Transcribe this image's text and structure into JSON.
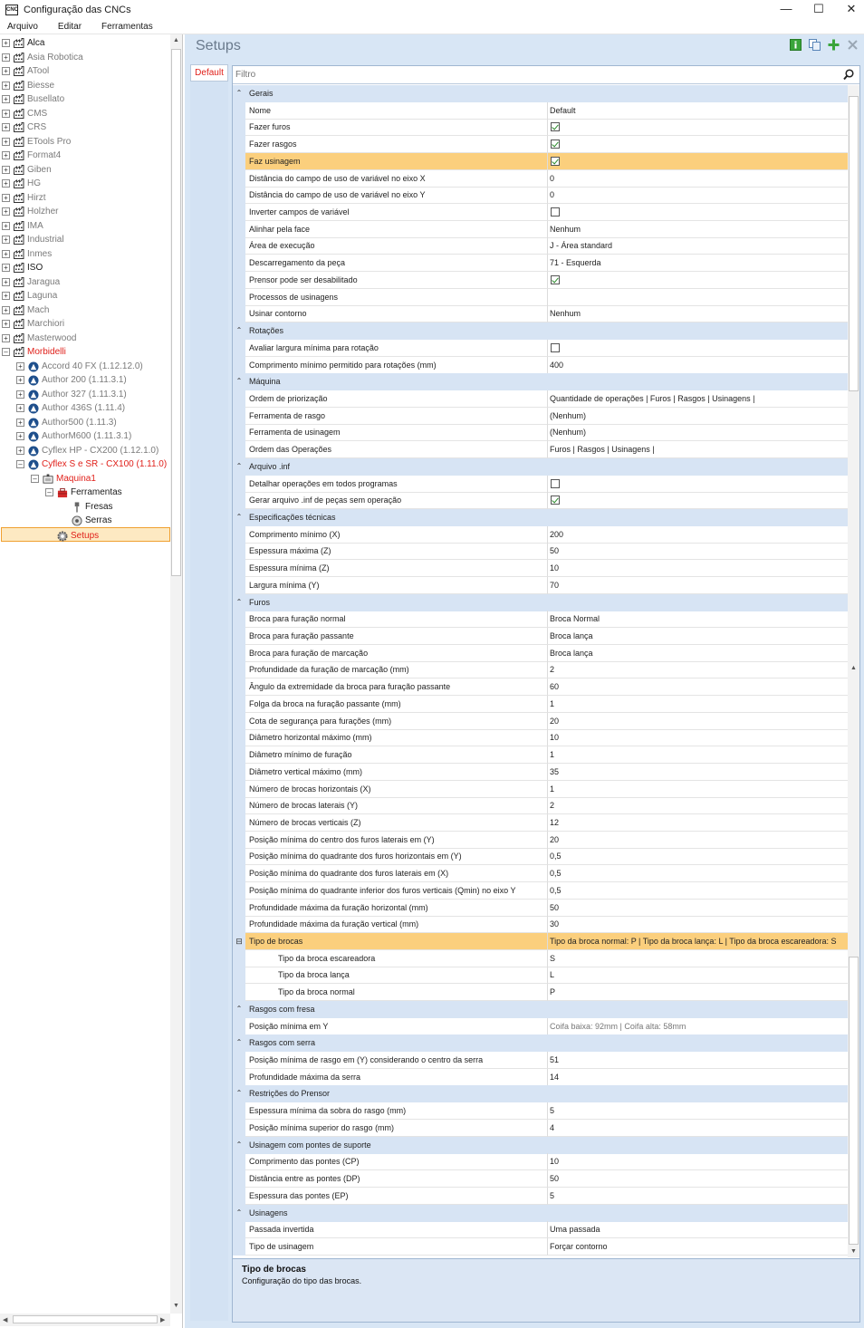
{
  "window": {
    "title": "Configuração das CNCs",
    "app_icon": "CNC",
    "minimize": "—",
    "maximize": "☐",
    "close": "✕"
  },
  "menu": [
    "Arquivo",
    "Editar",
    "Ferramentas"
  ],
  "tree": {
    "manufacturers": [
      "Alca",
      "Asia Robotica",
      "ATool",
      "Biesse",
      "Busellato",
      "CMS",
      "CRS",
      "ETools Pro",
      "Format4",
      "Giben",
      "HG",
      "Hirzt",
      "Holzher",
      "IMA",
      "Industrial",
      "Inmes",
      "ISO",
      "Jaragua",
      "Laguna",
      "Mach",
      "Marchiori",
      "Masterwood",
      "Morbidelli"
    ],
    "machines": [
      "Accord 40 FX (1.12.12.0)",
      "Author 200 (1.11.3.1)",
      "Author 327 (1.11.3.1)",
      "Author 436S (1.11.4)",
      "Author500 (1.11.3)",
      "AuthorM600 (1.11.3.1)",
      "Cyflex HP - CX200 (1.12.1.0)",
      "Cyflex S e SR - CX100 (1.11.0)"
    ],
    "machine_node": "Maquina1",
    "tools_node": "Ferramentas",
    "tool_items": [
      "Fresas",
      "Serras"
    ],
    "setups_node": "Setups"
  },
  "panel": {
    "header": "Setups",
    "tab": "Default",
    "filter_placeholder": "Filtro",
    "description_title": "Tipo de brocas",
    "description_text": "Configuração do tipo das brocas."
  },
  "grid": [
    {
      "t": "cat",
      "n": "Gerais"
    },
    {
      "t": "p",
      "n": "Nome",
      "v": "Default"
    },
    {
      "t": "p",
      "n": "Fazer furos",
      "c": true
    },
    {
      "t": "p",
      "n": "Fazer rasgos",
      "c": true
    },
    {
      "t": "p",
      "n": "Faz usinagem",
      "c": true,
      "hl": true
    },
    {
      "t": "p",
      "n": "Distância do campo de uso de variável no eixo X",
      "v": "0"
    },
    {
      "t": "p",
      "n": "Distância do campo de uso de variável no eixo Y",
      "v": "0"
    },
    {
      "t": "p",
      "n": "Inverter campos de variável",
      "c": false
    },
    {
      "t": "p",
      "n": "Alinhar pela face",
      "v": "Nenhum"
    },
    {
      "t": "p",
      "n": "Área de execução",
      "v": "J -  Área standard"
    },
    {
      "t": "p",
      "n": "Descarregamento da peça",
      "v": "71 -  Esquerda"
    },
    {
      "t": "p",
      "n": "Prensor pode ser desabilitado",
      "c": true
    },
    {
      "t": "p",
      "n": "Processos de usinagens",
      "v": ""
    },
    {
      "t": "p",
      "n": "Usinar contorno",
      "v": "Nenhum"
    },
    {
      "t": "cat",
      "n": "Rotações"
    },
    {
      "t": "p",
      "n": "Avaliar largura mínima para rotação",
      "c": false
    },
    {
      "t": "p",
      "n": "Comprimento mínimo permitido para rotações (mm)",
      "v": "400"
    },
    {
      "t": "cat",
      "n": "Máquina"
    },
    {
      "t": "p",
      "n": "Ordem de priorização",
      "v": "Quantidade de operações | Furos | Rasgos | Usinagens |"
    },
    {
      "t": "p",
      "n": "Ferramenta de rasgo",
      "v": "(Nenhum)"
    },
    {
      "t": "p",
      "n": "Ferramenta de usinagem",
      "v": "(Nenhum)"
    },
    {
      "t": "p",
      "n": "Ordem das Operações",
      "v": "Furos | Rasgos | Usinagens |"
    },
    {
      "t": "cat",
      "n": "Arquivo .inf"
    },
    {
      "t": "p",
      "n": "Detalhar operações em todos programas",
      "c": false
    },
    {
      "t": "p",
      "n": "Gerar arquivo .inf de peças sem operação",
      "c": true
    },
    {
      "t": "cat",
      "n": "Especificações técnicas"
    },
    {
      "t": "p",
      "n": "Comprimento mínimo (X)",
      "v": "200"
    },
    {
      "t": "p",
      "n": "Espessura máxima (Z)",
      "v": "50"
    },
    {
      "t": "p",
      "n": "Espessura mínima (Z)",
      "v": "10"
    },
    {
      "t": "p",
      "n": "Largura mínima (Y)",
      "v": "70"
    },
    {
      "t": "cat",
      "n": "Furos"
    },
    {
      "t": "p",
      "n": "Broca para furação normal",
      "v": "Broca Normal"
    },
    {
      "t": "p",
      "n": "Broca para furação passante",
      "v": "Broca lança"
    },
    {
      "t": "p",
      "n": "Broca para furação de marcação",
      "v": "Broca lança"
    },
    {
      "t": "p",
      "n": "Profundidade da furação de marcação (mm)",
      "v": "2"
    },
    {
      "t": "p",
      "n": "Ângulo da extremidade da broca para furação passante",
      "v": "60"
    },
    {
      "t": "p",
      "n": "Folga da broca na furação passante (mm)",
      "v": "1"
    },
    {
      "t": "p",
      "n": "Cota de segurança para furações (mm)",
      "v": "20"
    },
    {
      "t": "p",
      "n": "Diâmetro horizontal máximo (mm)",
      "v": "10"
    },
    {
      "t": "p",
      "n": "Diâmetro mínimo de furação",
      "v": "1"
    },
    {
      "t": "p",
      "n": "Diâmetro vertical máximo (mm)",
      "v": "35"
    },
    {
      "t": "p",
      "n": "Número de brocas horizontais (X)",
      "v": "1"
    },
    {
      "t": "p",
      "n": "Número de brocas laterais (Y)",
      "v": "2"
    },
    {
      "t": "p",
      "n": "Número de brocas verticais (Z)",
      "v": "12"
    },
    {
      "t": "p",
      "n": "Posição mínima do centro dos furos laterais em (Y)",
      "v": "20"
    },
    {
      "t": "p",
      "n": "Posição mínima do quadrante dos furos horizontais em (Y)",
      "v": "0,5"
    },
    {
      "t": "p",
      "n": "Posição mínima do quadrante dos furos laterais em (X)",
      "v": "0,5"
    },
    {
      "t": "p",
      "n": "Posição mínima do quadrante inferior dos furos verticais (Qmin) no eixo Y",
      "v": "0,5"
    },
    {
      "t": "p",
      "n": "Profundidade máxima da furação horizontal (mm)",
      "v": "50"
    },
    {
      "t": "p",
      "n": "Profundidade máxima da furação vertical (mm)",
      "v": "30"
    },
    {
      "t": "p",
      "n": "Tipo de brocas",
      "v": " Tipo da broca normal: P  |  Tipo da broca lança: L  |  Tipo da broca escareadora: S",
      "hl": true,
      "exp": "minus"
    },
    {
      "t": "sub",
      "n": "Tipo da broca escareadora",
      "v": "S"
    },
    {
      "t": "sub",
      "n": "Tipo da broca lança",
      "v": "L"
    },
    {
      "t": "sub",
      "n": "Tipo da broca normal",
      "v": "P"
    },
    {
      "t": "cat",
      "n": "Rasgos com fresa"
    },
    {
      "t": "p",
      "n": "Posição mínima em Y",
      "v": " Coifa baixa: 92mm | Coifa alta: 58mm",
      "dim": true
    },
    {
      "t": "cat",
      "n": "Rasgos com serra"
    },
    {
      "t": "p",
      "n": "Posição mínima de rasgo em (Y) considerando o centro da serra",
      "v": " 51"
    },
    {
      "t": "p",
      "n": "Profundidade máxima da serra",
      "v": " 14"
    },
    {
      "t": "cat",
      "n": "Restrições do Prensor"
    },
    {
      "t": "p",
      "n": "Espessura mínima da sobra do rasgo (mm)",
      "v": " 5"
    },
    {
      "t": "p",
      "n": "Posição mínima superior do rasgo (mm)",
      "v": " 4"
    },
    {
      "t": "cat",
      "n": "Usinagem com pontes de suporte"
    },
    {
      "t": "p",
      "n": "Comprimento das pontes (CP)",
      "v": " 10"
    },
    {
      "t": "p",
      "n": "Distância entre as pontes (DP)",
      "v": " 50"
    },
    {
      "t": "p",
      "n": "Espessura das pontes (EP)",
      "v": " 5"
    },
    {
      "t": "cat",
      "n": "Usinagens"
    },
    {
      "t": "p",
      "n": "Passada invertida",
      "v": " Uma passada"
    },
    {
      "t": "p",
      "n": "Tipo de usinagem",
      "v": " Forçar contorno"
    }
  ],
  "icons": {
    "tree_expand": "⊞",
    "tree_collapse": "⊟",
    "category_collapse": "⌃"
  },
  "colors": {
    "selection_fill": "#fbcf7d",
    "tree_selection": "#fde9c2",
    "red_text": "#e0201a",
    "panel_bg": "#d8e6f5"
  }
}
